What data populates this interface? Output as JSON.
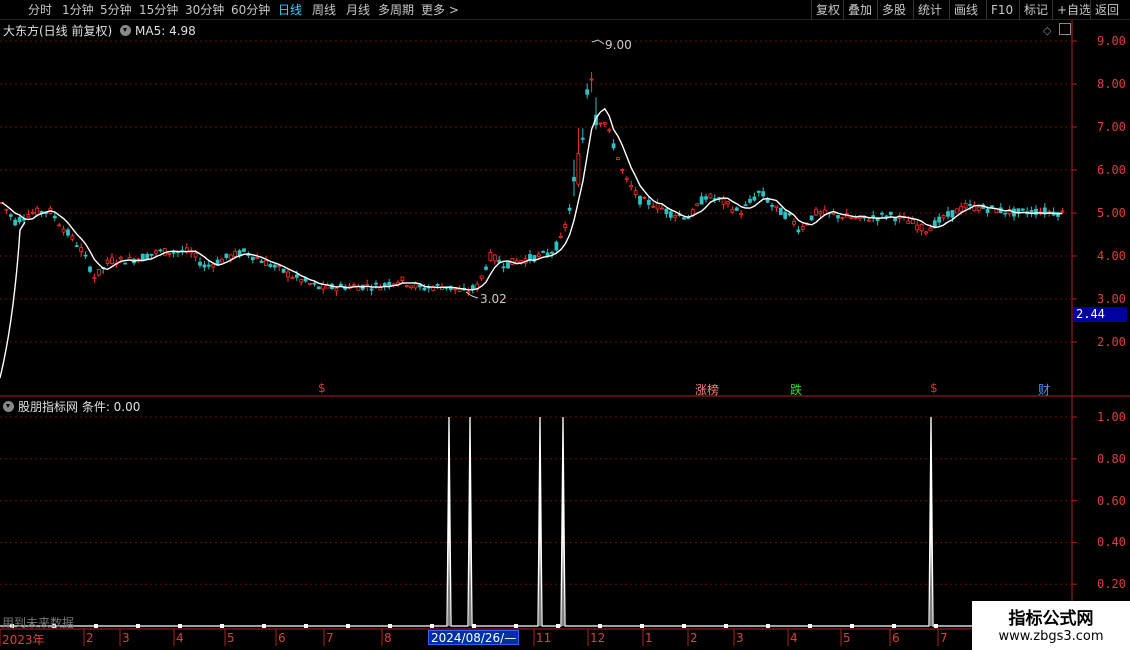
{
  "toolbar": {
    "periods": [
      "分时",
      "1分钟",
      "5分钟",
      "15分钟",
      "30分钟",
      "60分钟",
      "日线",
      "周线",
      "月线",
      "多周期",
      "更多 >"
    ],
    "active_period": "日线",
    "right_buttons": [
      "复权",
      "叠加",
      "多股",
      "统计",
      "画线",
      "F10",
      "标记",
      "+自选",
      "返回"
    ]
  },
  "main_panel": {
    "title": "大东方(日线 前复权)",
    "ma_label": "MA5: 4.98",
    "y_ticks": [
      "9.00",
      "8.00",
      "7.00",
      "6.00",
      "5.00",
      "4.00",
      "3.00",
      "2.00"
    ],
    "high_label": "9.00",
    "low_label": "3.02",
    "current_price_tag": "2.44",
    "event_markers": [
      {
        "text": "$",
        "color": "#e03030"
      },
      {
        "text": "涨榜",
        "color": "#ff8080"
      },
      {
        "text": "跌",
        "color": "#30e030"
      },
      {
        "text": "$",
        "color": "#e03030"
      },
      {
        "text": "财",
        "color": "#5090ff"
      }
    ]
  },
  "indicator_panel": {
    "title": "股朋指标网 条件: 0.00",
    "y_ticks": [
      "1.00",
      "0.80",
      "0.60",
      "0.40",
      "0.20"
    ],
    "footnote": "用到未来数据"
  },
  "x_axis": {
    "labels": [
      "2023年",
      "2",
      "3",
      "4",
      "5",
      "6",
      "7",
      "8",
      "11",
      "12",
      "1",
      "2",
      "3",
      "4",
      "5",
      "6",
      "7"
    ],
    "hover_date": "2024/08/26/—"
  },
  "watermark": {
    "title": "指标公式网",
    "url": "www.zbgs3.com"
  },
  "chart_data": {
    "type": "candlestick",
    "title": "大东方(日线 前复权)",
    "ylim": [
      1.0,
      9.4
    ],
    "ma_period": 5,
    "close_approx": [
      {
        "x": "2023年",
        "y": 5.0
      },
      {
        "x": "2",
        "y": 4.1
      },
      {
        "x": "3",
        "y": 4.0
      },
      {
        "x": "4",
        "y": 4.1
      },
      {
        "x": "5",
        "y": 4.0
      },
      {
        "x": "6",
        "y": 3.6
      },
      {
        "x": "7",
        "y": 3.3
      },
      {
        "x": "8",
        "y": 3.4
      },
      {
        "x": "2024/08/26/—",
        "y": 3.1
      },
      {
        "x": "11",
        "y": 4.2
      },
      {
        "x": "12",
        "y": 7.3
      },
      {
        "x": "1",
        "y": 5.2
      },
      {
        "x": "2",
        "y": 5.0
      },
      {
        "x": "3",
        "y": 5.3
      },
      {
        "x": "4",
        "y": 4.8
      },
      {
        "x": "5",
        "y": 4.9
      },
      {
        "x": "6",
        "y": 4.8
      },
      {
        "x": "7",
        "y": 5.0
      }
    ],
    "high": 9.0,
    "low": 3.02,
    "indicator": {
      "name": "条件",
      "ylim": [
        0,
        1.0
      ],
      "signal_value": 1.0,
      "signal_count": 5
    }
  }
}
